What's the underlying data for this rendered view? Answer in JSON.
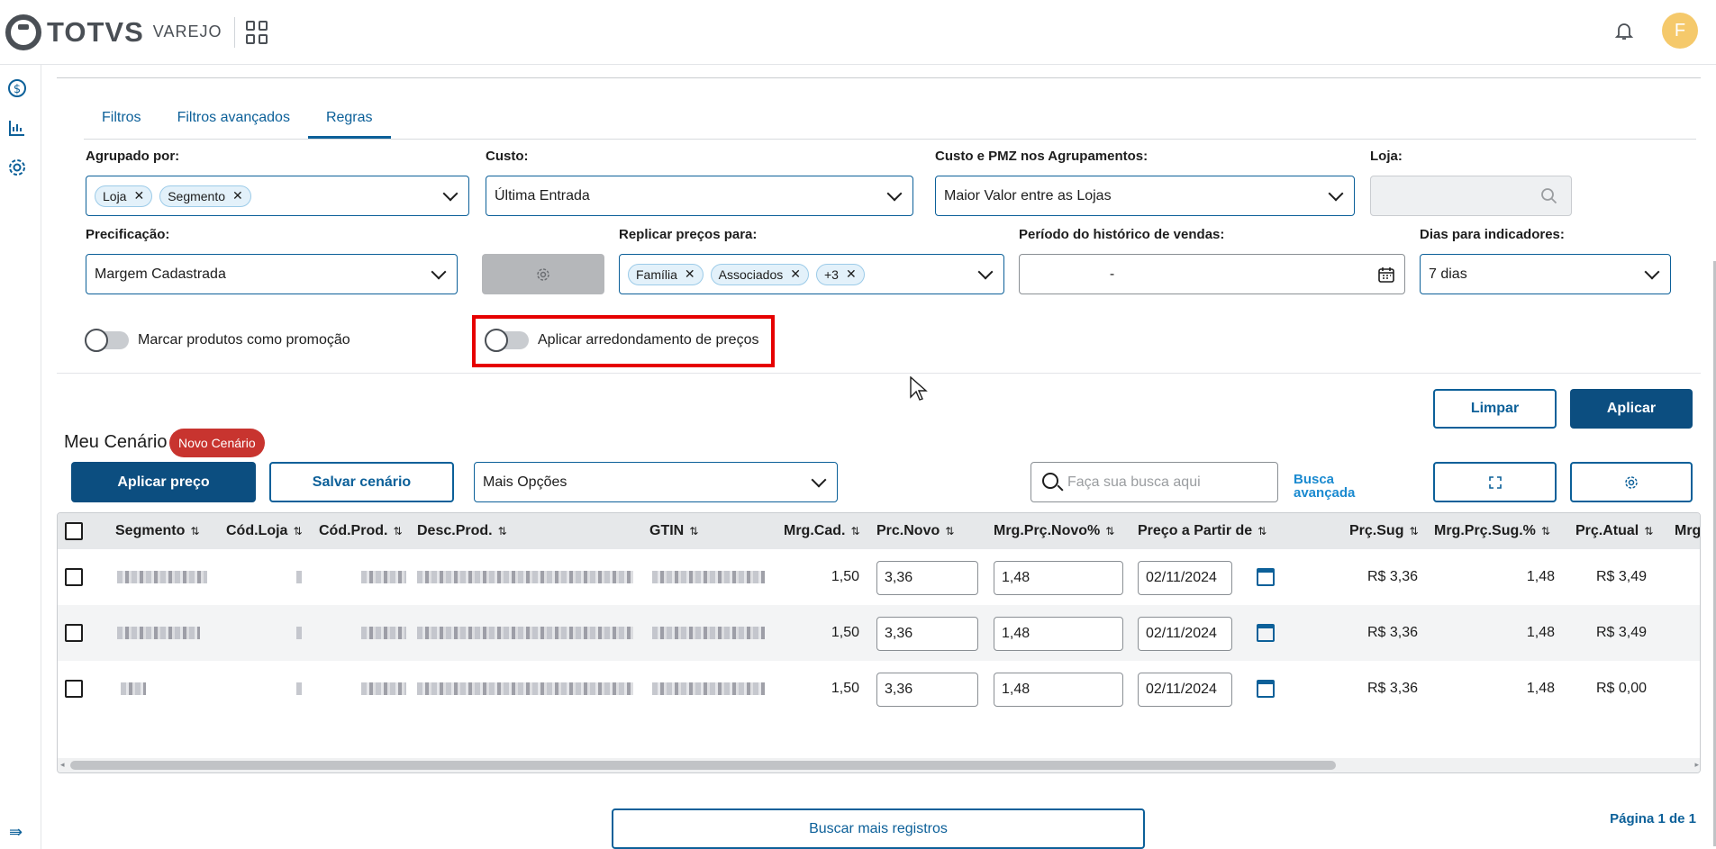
{
  "app": {
    "brand_name": "TOTVS",
    "brand_sub": "VAREJO",
    "avatar_initial": "F"
  },
  "tabs": [
    "Filtros",
    "Filtros avançados",
    "Regras"
  ],
  "form": {
    "agrupado_label": "Agrupado por:",
    "agrupado_chips": [
      "Loja",
      "Segmento"
    ],
    "custo_label": "Custo:",
    "custo_value": "Última Entrada",
    "custo_pmz_label": "Custo e PMZ nos Agrupamentos:",
    "custo_pmz_value": "Maior Valor entre as Lojas",
    "loja_label": "Loja:",
    "precificacao_label": "Precificação:",
    "precificacao_value": "Margem Cadastrada",
    "replicar_label": "Replicar preços para:",
    "replicar_chips": [
      "Família",
      "Associados",
      "+3"
    ],
    "periodo_label": "Período do histórico de vendas:",
    "periodo_value": "-",
    "dias_label": "Dias para indicadores:",
    "dias_value": "7 dias",
    "toggle_promocao": "Marcar produtos como promoção",
    "toggle_arredondamento": "Aplicar arredondamento de preços"
  },
  "actions": {
    "limpar": "Limpar",
    "aplicar": "Aplicar"
  },
  "scenario": {
    "title": "Meu Cenário",
    "badge": "Novo Cenário",
    "aplicar_preco": "Aplicar preço",
    "salvar_cenario": "Salvar cenário",
    "mais_opcoes": "Mais Opções",
    "search_placeholder": "Faça sua busca aqui",
    "busca_line1": "Busca",
    "busca_line2": "avançada"
  },
  "table": {
    "headers": [
      "Segmento",
      "Cód.Loja",
      "Cód.Prod.",
      "Desc.Prod.",
      "GTIN",
      "Mrg.Cad.",
      "Prc.Novo",
      "Mrg.Prç.Novo%",
      "Preço a Partir de",
      "Prç.Sug",
      "Mrg.Prç.Sug.%",
      "Prç.Atual",
      "Mrg"
    ],
    "rows": [
      {
        "mrg_cad": "1,50",
        "prc_novo": "3,36",
        "mrg_novo": "1,48",
        "data": "02/11/2024",
        "prc_sug": "R$ 3,36",
        "mrg_sug": "1,48",
        "prc_atual": "R$ 3,49"
      },
      {
        "mrg_cad": "1,50",
        "prc_novo": "3,36",
        "mrg_novo": "1,48",
        "data": "02/11/2024",
        "prc_sug": "R$ 3,36",
        "mrg_sug": "1,48",
        "prc_atual": "R$ 3,49"
      },
      {
        "mrg_cad": "1,50",
        "prc_novo": "3,36",
        "mrg_novo": "1,48",
        "data": "02/11/2024",
        "prc_sug": "R$ 3,36",
        "mrg_sug": "1,48",
        "prc_atual": "R$ 0,00"
      }
    ]
  },
  "footer": {
    "buscar_mais": "Buscar mais registros",
    "pagina": "Página 1 de 1"
  },
  "icons": [
    "dollar-icon",
    "chart-icon",
    "gear-icon",
    "bell-icon",
    "apps-grid-icon",
    "search-icon",
    "calendar-icon",
    "expand-icon",
    "collapse-menu-icon"
  ],
  "colors": {
    "primary": "#0c6099",
    "primary_dark": "#0c4e80",
    "badge_red": "#c8342f",
    "highlight_red": "#e60000",
    "avatar_yellow": "#f5c96b"
  }
}
